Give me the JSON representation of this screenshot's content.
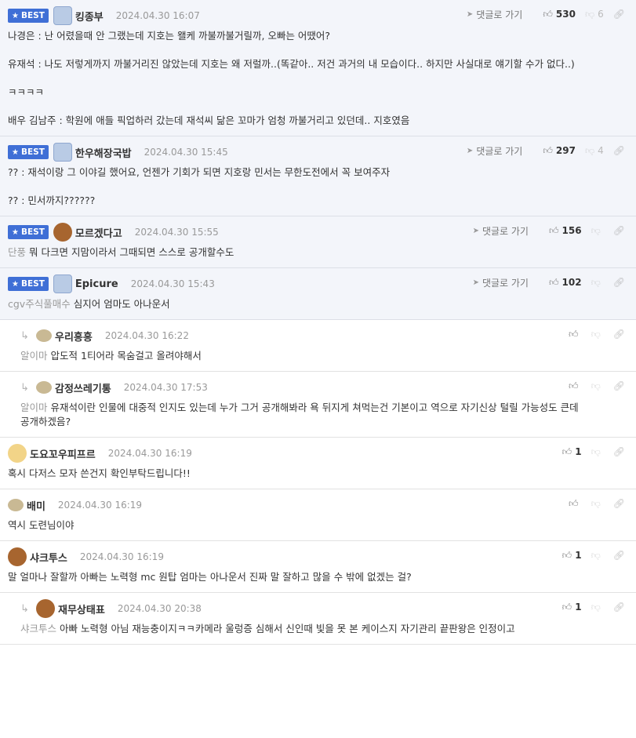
{
  "labels": {
    "best": "BEST",
    "goto": "댓글로 가기"
  },
  "comments": [
    {
      "best": true,
      "avatar": "user-avatar-blue",
      "nick": "킹종부",
      "date": "2024.04.30 16:07",
      "likes": "530",
      "dislikes": "6",
      "text": "나경은 : 난 어렸을때 안 그랬는데 지호는 왤케 까불까불거릴까, 오빠는 어땠어?\n\n유재석 : 나도 저렇게까지 까불거리진 않았는데 지호는 왜 저럴까..(똑같아.. 저건 과거의 내 모습이다.. 하지만 사실대로 얘기할 수가 없다..)\n\nㅋㅋㅋㅋ\n\n배우 김남주 : 학원에 애들 픽업하러 갔는데 재석씨 닮은 꼬마가 엄청 까불거리고 있던데.. 지호였음"
    },
    {
      "best": true,
      "avatar": "user-avatar-blue",
      "nick": "한우해장국밥",
      "date": "2024.04.30 15:45",
      "likes": "297",
      "dislikes": "4",
      "text": "?? : 재석이랑 그 이야길 했어요, 언젠가 기회가 되면 지호랑 민서는 무한도전에서 꼭 보여주자\n\n?? : 민서까지??????"
    },
    {
      "best": true,
      "avatar": "user-avatar-brown",
      "nick": "모르겠다고",
      "date": "2024.04.30 15:55",
      "likes": "156",
      "dislikes": "",
      "mention": "단풍",
      "text": "뭐 다크면 지맘이라서 그때되면 스스로 공개할수도"
    },
    {
      "best": true,
      "avatar": "user-avatar-blue",
      "nick": "Epicure",
      "date": "2024.04.30 15:43",
      "likes": "102",
      "dislikes": "",
      "mention": "cgv주식풀매수",
      "text": "심지어 엄마도 아나운서"
    },
    {
      "best": false,
      "reply": true,
      "avatar": "user-avatar-dot",
      "nick": "우리흥흥",
      "date": "2024.04.30 16:22",
      "likes": "",
      "dislikes": "",
      "mention": "알이마",
      "text": "압도적 1티어라 목숨걸고 올려야해서"
    },
    {
      "best": false,
      "reply": true,
      "avatar": "user-avatar-dot",
      "nick": "감정쓰레기통",
      "date": "2024.04.30 17:53",
      "likes": "",
      "dislikes": "",
      "mention": "알이마",
      "text": "유재석이란 인물에 대중적 인지도 있는데 누가 그거 공개해봐라 욕 뒤지게 쳐먹는건 기본이고 역으로 자기신상 털릴 가능성도 큰데 공개하겠음?"
    },
    {
      "best": false,
      "avatar": "user-avatar-fox",
      "nick": "도요꼬우피프르",
      "date": "2024.04.30 16:19",
      "likes": "1",
      "dislikes": "",
      "text": "혹시 다저스 모자 쓴건지 확인부탁드립니다!!"
    },
    {
      "best": false,
      "avatar": "user-avatar-dot",
      "nick": "배미",
      "date": "2024.04.30 16:19",
      "likes": "",
      "dislikes": "",
      "text": "역시 도련님이야"
    },
    {
      "best": false,
      "avatar": "user-avatar-brown",
      "nick": "샤크투스",
      "date": "2024.04.30 16:19",
      "likes": "1",
      "dislikes": "",
      "text": "말 얼마나 잘할까 아빠는 노력형 mc 원탑 엄마는 아나운서 진짜 말 잘하고 많을 수 밖에 없겠는 걸?"
    },
    {
      "best": false,
      "reply": true,
      "avatar": "user-avatar-brown",
      "nick": "재무상태표",
      "date": "2024.04.30 20:38",
      "likes": "1",
      "dislikes": "",
      "mention": "샤크투스",
      "text": "아빠 노력형 아님 재능충이지ㅋㅋ카메라 울렁증 심해서 신인때 빛을 못 본 케이스지 자기관리 끝판왕은 인정이고"
    }
  ]
}
